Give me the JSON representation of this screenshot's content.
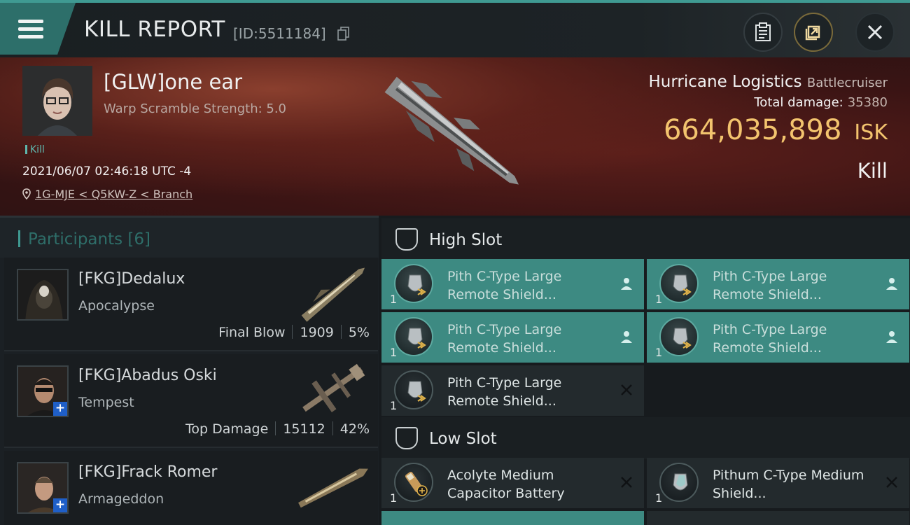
{
  "header": {
    "title": "KILL REPORT",
    "kill_id": "[ID:5511184]"
  },
  "victim": {
    "name": "[GLW]one ear",
    "scramble": "Warp Scramble Strength: 5.0",
    "tag": "Kill",
    "timestamp": "2021/06/07 02:46:18 UTC -4",
    "location": "1G-MJE < Q5KW-Z < Branch",
    "ship_name": "Hurricane Logistics",
    "ship_class": "Battlecruiser",
    "total_damage_label": "Total damage:",
    "total_damage": "35380",
    "isk_value": "664,035,898",
    "isk_unit": "ISK",
    "result": "Kill"
  },
  "participants": {
    "title": "Participants [6]",
    "items": [
      {
        "name": "[FKG]Dedalux",
        "ship": "Apocalypse",
        "role": "Final Blow",
        "damage": "1909",
        "percent": "5%"
      },
      {
        "name": "[FKG]Abadus Oski",
        "ship": "Tempest",
        "role": "Top Damage",
        "damage": "15112",
        "percent": "42%"
      },
      {
        "name": "[FKG]Frack Romer",
        "ship": "Armageddon"
      }
    ]
  },
  "slots": {
    "high": {
      "title": "High Slot",
      "modules": [
        {
          "qty": "1",
          "name": "Pith C-Type Large Remote Shield...",
          "status": "dropped"
        },
        {
          "qty": "1",
          "name": "Pith C-Type Large Remote Shield...",
          "status": "dropped"
        },
        {
          "qty": "1",
          "name": "Pith C-Type Large Remote Shield...",
          "status": "dropped"
        },
        {
          "qty": "1",
          "name": "Pith C-Type Large Remote Shield...",
          "status": "dropped"
        },
        {
          "qty": "1",
          "name": "Pith C-Type Large Remote Shield...",
          "status": "destroyed"
        }
      ]
    },
    "low": {
      "title": "Low Slot",
      "modules": [
        {
          "qty": "1",
          "name": "Acolyte Medium Capacitor Battery",
          "status": "destroyed"
        },
        {
          "qty": "1",
          "name": "Pithum C-Type Medium Shield...",
          "status": "destroyed"
        }
      ]
    }
  },
  "colors": {
    "accent": "#3f9a92",
    "isk": "#f3c46e",
    "dropped_module": "#3d8a82",
    "destroyed_module": "#232a2d"
  }
}
